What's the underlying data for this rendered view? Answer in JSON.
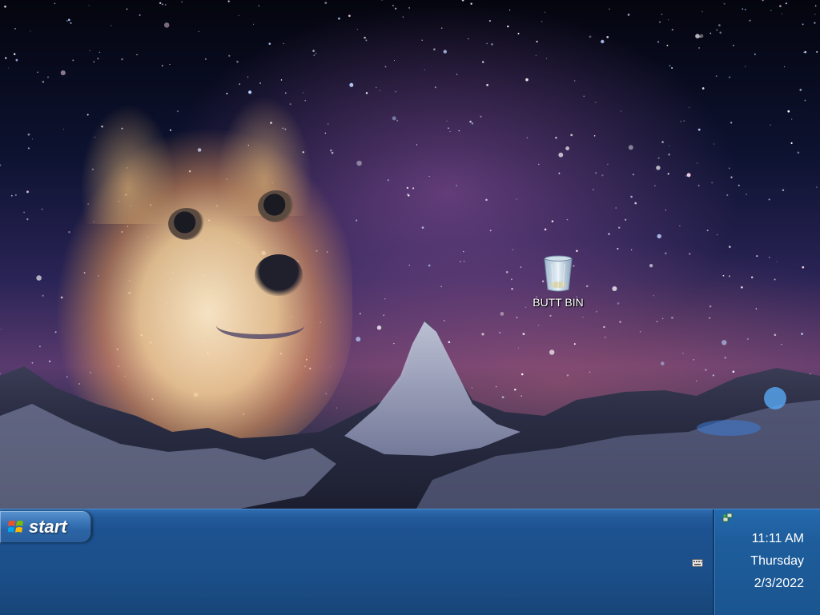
{
  "desktop": {
    "icons": [
      {
        "name": "recycle-bin",
        "label": "BUTT BIN",
        "icon": "recycle-bin-icon"
      }
    ]
  },
  "taskbar": {
    "start_label": "start",
    "start_icon": "windows-flag-icon",
    "tray": {
      "icons": [
        "network-icon",
        "keyboard-icon"
      ],
      "time": "11:11 AM",
      "day": "Thursday",
      "date": "2/3/2022"
    }
  },
  "colors": {
    "taskbar": "#1d5290",
    "start_button": "#3b76b8",
    "tray": "#1e5d9c",
    "text": "#ffffff"
  }
}
